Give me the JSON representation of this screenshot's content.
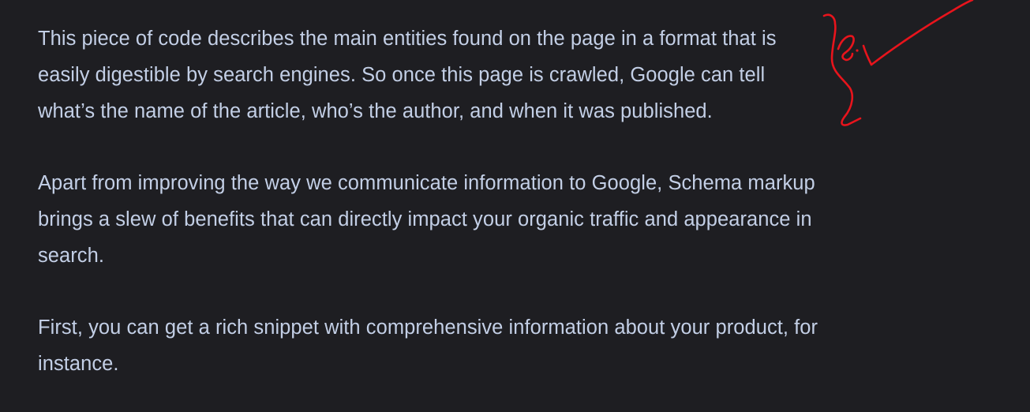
{
  "article": {
    "paragraphs": [
      "This piece of code describes the main entities found on the page in a format that is\neasily digestible by search engines. So once this page is crawled, Google can tell\nwhat’s the name of the article, who’s the author, and when it was published.",
      "Apart from improving the way we communicate information to Google, Schema markup\nbrings a slew of benefits that can directly impact your organic traffic and appearance in\nsearch.",
      "First, you can get a rich snippet with comprehensive information about your product, for\ninstance."
    ]
  },
  "annotation": {
    "color": "#e8141c"
  },
  "colors": {
    "background": "#1e1e22",
    "text": "#c3cfe6"
  }
}
